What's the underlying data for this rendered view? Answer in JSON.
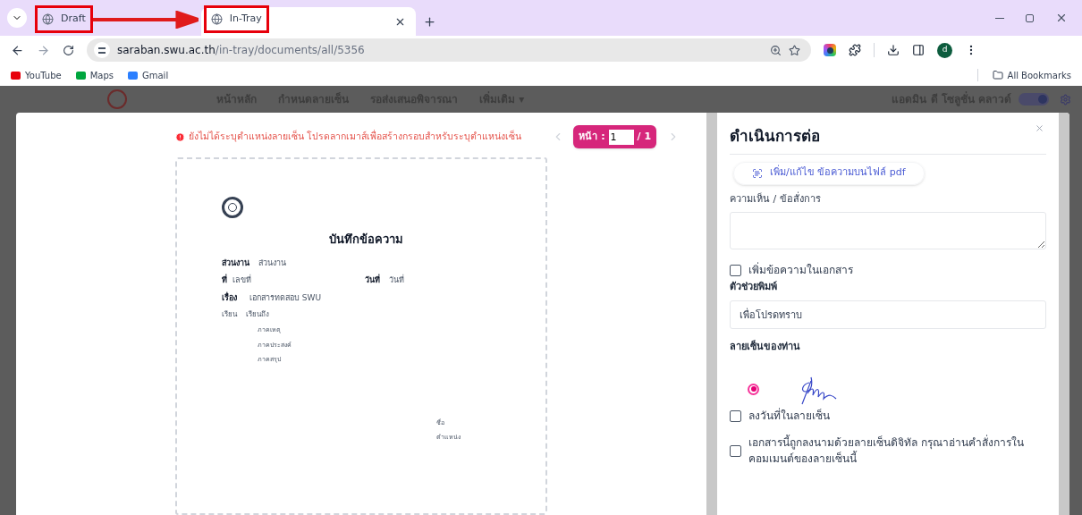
{
  "browser": {
    "tabs": [
      {
        "label": "Draft",
        "selected": false
      },
      {
        "label": "In-Tray",
        "selected": true
      }
    ],
    "address": {
      "domain": "saraban.swu.ac.th",
      "path": "/in-tray/documents/all/5356"
    },
    "profile_initial": "d",
    "bookmarks": [
      "YouTube",
      "Maps",
      "Gmail"
    ],
    "all_bookmarks": "All Bookmarks"
  },
  "background_nav": {
    "items": [
      "หน้าหลัก",
      "กำหนดลายเซ็น",
      "รอส่งเสนอพิจารณา",
      "เพิ่มเติม ▾"
    ],
    "user": "แอดมิน ดี โซลูชั่น คลาวด์",
    "toggle_on": true
  },
  "viewer": {
    "warning": "ยังไม่ได้ระบุตำแหน่งลายเซ็น โปรดลากเมาส์เพื่อสร้างกรอบสำหรับระบุตำแหน่งเซ็น",
    "pager": {
      "label": "หน้า :",
      "page": "1",
      "total": "/ 1"
    }
  },
  "document": {
    "title": "บันทึกข้อความ",
    "fields": [
      {
        "label": "ส่วนงาน",
        "value": "ส่วนงาน"
      },
      {
        "label": "ที่",
        "value": "เลขที่"
      },
      {
        "label": "วันที่",
        "value": "วันที่"
      },
      {
        "label": "เรื่อง",
        "value": "เอกสารทดสอบ SWU"
      },
      {
        "label": "เรียน",
        "value": "เรียนถึง"
      }
    ],
    "sections": [
      "ภาคเหตุ",
      "ภาคประสงค์",
      "ภาคสรุป"
    ],
    "signature_lines": [
      "ชื่อ",
      "ตำแหน่ง"
    ]
  },
  "panel": {
    "title": "ดำเนินการต่อ",
    "pdf_button": "เพิ่ม/แก้ไข ข้อความบนไฟล์ pdf",
    "comment_label": "ความเห็น / ข้อสั่งการ",
    "add_text": {
      "label": "เพิ่มข้อความในเอกสาร",
      "checked": false
    },
    "helper_label": "ตัวช่วยพิมพ์",
    "helper_value": "เพื่อโปรดทราบ",
    "signature_label": "ลายเซ็นของท่าน",
    "signatures": [
      {
        "selected": true
      }
    ],
    "options": [
      {
        "label": "ลงวันที่ในลายเซ็น",
        "checked": false
      },
      {
        "label": "เอกสารนี้ถูกลงนามด้วยลายเซ็นดิจิทัล กรุณาอ่านคำสั่งการในคอมเมนต์ของลายเซ็นนี้",
        "checked": false
      }
    ]
  }
}
